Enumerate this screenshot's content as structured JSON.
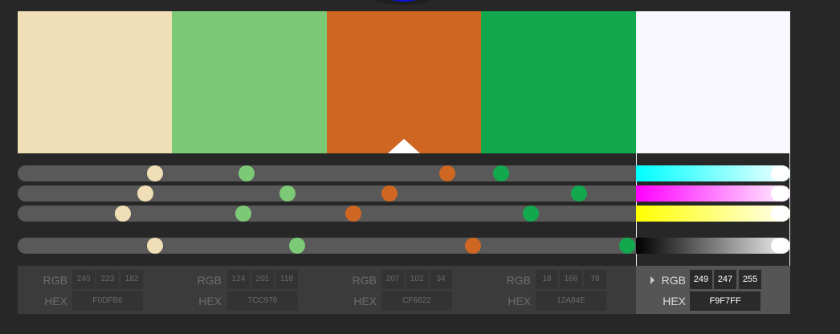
{
  "colors": [
    {
      "name": "color-1",
      "hex_value": "#F0DFB6",
      "rgb": {
        "r": "240",
        "g": "223",
        "b": "182"
      },
      "hex": "F0DFB6",
      "active": false
    },
    {
      "name": "color-2",
      "hex_value": "#7CC976",
      "rgb": {
        "r": "124",
        "g": "201",
        "b": "118"
      },
      "hex": "7CC976",
      "active": false
    },
    {
      "name": "color-3",
      "hex_value": "#CF6622",
      "rgb": {
        "r": "207",
        "g": "102",
        "b": "34"
      },
      "hex": "CF6622",
      "active": false
    },
    {
      "name": "color-4",
      "hex_value": "#12A84E",
      "rgb": {
        "r": "18",
        "g": "168",
        "b": "78"
      },
      "hex": "12A84E",
      "active": false
    },
    {
      "name": "color-5",
      "hex_value": "#F9F7FF",
      "rgb": {
        "r": "249",
        "g": "247",
        "b": "255"
      },
      "hex": "F9F7FF",
      "active": true
    }
  ],
  "labels": {
    "rgb": "RGB",
    "hex": "HEX"
  },
  "sliders": {
    "cyan": [
      0.222,
      0.37,
      0.695,
      0.782
    ],
    "magenta": [
      0.206,
      0.436,
      0.601,
      0.908
    ],
    "yellow": [
      0.17,
      0.365,
      0.543,
      0.83
    ],
    "key": [
      0.222,
      0.452,
      0.737,
      0.986
    ]
  }
}
